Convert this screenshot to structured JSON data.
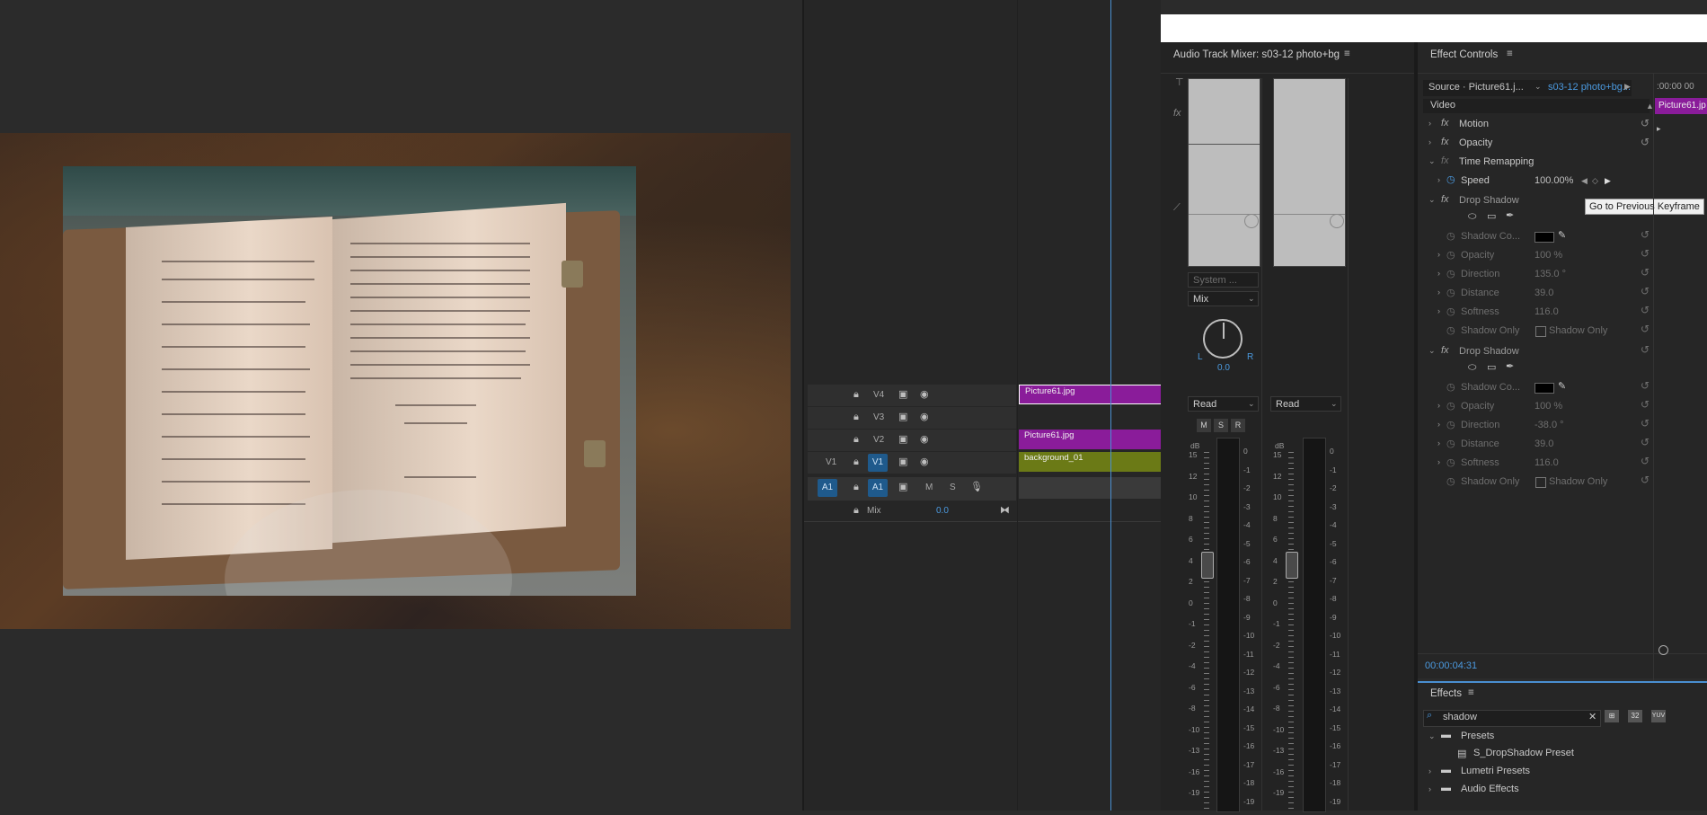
{
  "timeline": {
    "tracks": [
      {
        "name": "V4",
        "source": ""
      },
      {
        "name": "V3",
        "source": ""
      },
      {
        "name": "V2",
        "source": ""
      },
      {
        "name": "V1",
        "source": "V1"
      },
      {
        "name": "A1",
        "source": "A1"
      }
    ],
    "mix_label": "Mix",
    "mix_value": "0.0",
    "audio_buttons": {
      "m": "M",
      "s": "S"
    },
    "clips": {
      "v4": "Picture61.jpg",
      "v2": "Picture61.jpg",
      "v1": "background_01"
    }
  },
  "mixer": {
    "title": "Audio Track Mixer: s03-12 photo+bg",
    "system_label": "System ...",
    "mix_select": "Mix",
    "pan_l": "L",
    "pan_r": "R",
    "pan_value": "0.0",
    "ch1_mode": "Read",
    "ch2_mode": "Read",
    "msr": [
      "M",
      "S",
      "R"
    ],
    "db_label": "dB",
    "left_scale": [
      "15",
      "12",
      "10",
      "8",
      "6",
      "4",
      "2",
      "0",
      "-1",
      "-2",
      "-4",
      "-6",
      "-8",
      "-10",
      "-13",
      "-16",
      "-19"
    ],
    "right_scale": [
      "0",
      "-1",
      "-2",
      "-3",
      "-4",
      "-5",
      "-6",
      "-7",
      "-8",
      "-9",
      "-10",
      "-11",
      "-12",
      "-13",
      "-14",
      "-15",
      "-16",
      "-17",
      "-18",
      "-19"
    ]
  },
  "effect_controls": {
    "title": "Effect Controls",
    "source": "Source · Picture61.j...",
    "sequence": "s03-12 photo+bg...",
    "ruler": ":00:00  00",
    "clip_label": "Picture61.jp",
    "section": "Video",
    "motion": "Motion",
    "opacity": "Opacity",
    "time_remap": "Time Remapping",
    "speed_label": "Speed",
    "speed_value": "100.00%",
    "tooltip": "Go to Previous Keyframe",
    "shadow1": {
      "name": "Drop Shadow",
      "color_label": "Shadow Co...",
      "opacity_label": "Opacity",
      "opacity": "100 %",
      "direction_label": "Direction",
      "direction": "135.0 °",
      "distance_label": "Distance",
      "distance": "39.0",
      "softness_label": "Softness",
      "softness": "116.0",
      "shadow_only_label": "Shadow Only",
      "shadow_only_cb": "Shadow Only"
    },
    "shadow2": {
      "name": "Drop Shadow",
      "color_label": "Shadow Co...",
      "opacity_label": "Opacity",
      "opacity": "100 %",
      "direction_label": "Direction",
      "direction": "-38.0 °",
      "distance_label": "Distance",
      "distance": "39.0",
      "softness_label": "Softness",
      "softness": "116.0",
      "shadow_only_label": "Shadow Only",
      "shadow_only_cb": "Shadow Only"
    },
    "timecode": "00:00:04:31"
  },
  "effects_panel": {
    "title": "Effects",
    "search_value": "shadow",
    "tree": [
      {
        "label": "Presets"
      },
      {
        "label": "S_DropShadow Preset"
      },
      {
        "label": "Lumetri Presets"
      },
      {
        "label": "Audio Effects"
      }
    ],
    "icon_labels": [
      "32",
      "32",
      "YUV"
    ]
  }
}
